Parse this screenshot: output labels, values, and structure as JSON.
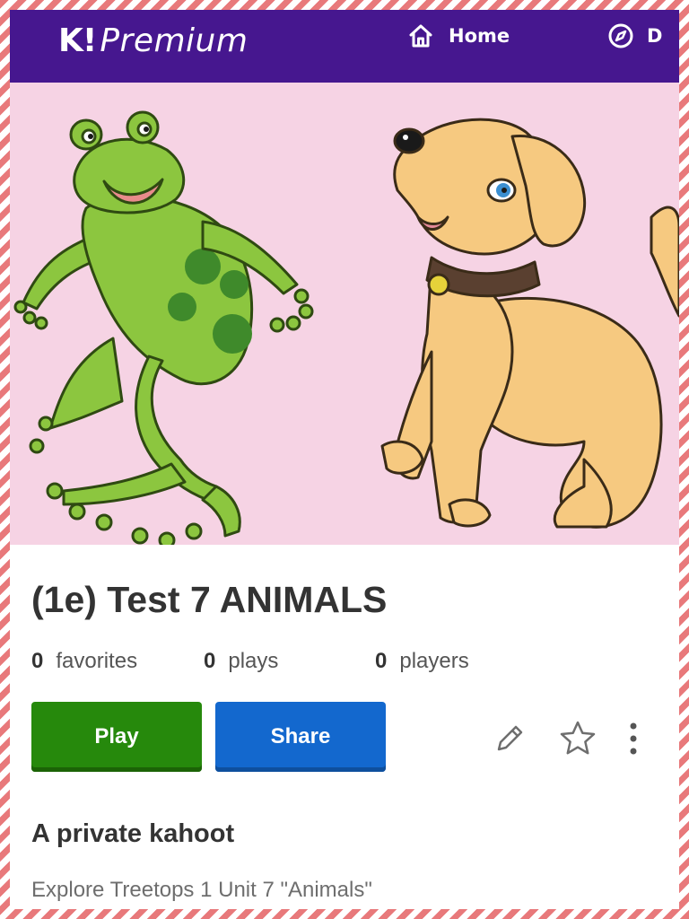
{
  "header": {
    "logo_k": "K!",
    "logo_text": "Premium",
    "nav": [
      {
        "label": "Home",
        "icon": "home-icon"
      },
      {
        "label": "D",
        "icon": "compass-icon"
      }
    ]
  },
  "cover": {
    "image": "frog and puppy cartoon illustration",
    "background": "#f6d3e4"
  },
  "kahoot": {
    "title": "(1e) Test 7 ANIMALS",
    "stats": [
      {
        "value": "0",
        "label": "favorites"
      },
      {
        "value": "0",
        "label": "plays"
      },
      {
        "value": "0",
        "label": "players"
      }
    ],
    "play_label": "Play",
    "share_label": "Share",
    "actions": [
      "pencil-icon",
      "star-icon",
      "more-vertical-icon"
    ],
    "visibility": "A private kahoot",
    "description": "Explore Treetops 1 Unit 7 \"Animals\""
  },
  "colors": {
    "brand_purple": "#46178f",
    "play_green": "#26890c",
    "share_blue": "#1368ce",
    "border_stripe": "#e8797b"
  }
}
